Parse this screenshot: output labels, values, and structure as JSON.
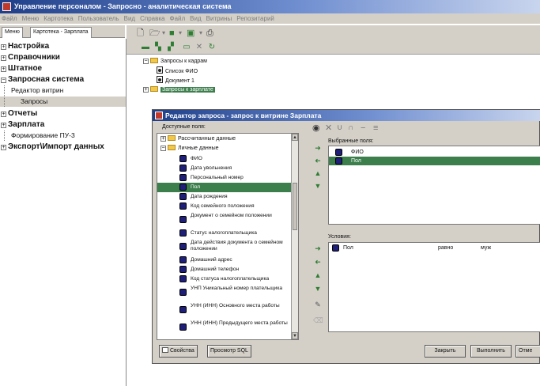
{
  "window": {
    "title": "Управление персоналом - Запросно - аналитическая система"
  },
  "menubar": [
    "Файл",
    "Меню",
    "Картотека",
    "Пользователь",
    "Вид",
    "Справка",
    "Файл",
    "Вид",
    "Витрины",
    "Репозитарий"
  ],
  "tabs": [
    "Меню",
    "Картотека - Зарплата"
  ],
  "tree": [
    {
      "label": "Настройка",
      "expander": "+",
      "bold": true
    },
    {
      "label": "Справочники",
      "expander": "+",
      "bold": true
    },
    {
      "label": "Штатное",
      "expander": "+",
      "bold": true
    },
    {
      "label": "Запросная система",
      "expander": "−",
      "bold": true
    },
    {
      "label": "Редактор витрин",
      "expander": "",
      "bold": false
    },
    {
      "label": "Запросы",
      "expander": "",
      "bold": false,
      "selected": true
    },
    {
      "label": "Отчеты",
      "expander": "+",
      "bold": true
    },
    {
      "label": "Зарплата",
      "expander": "+",
      "bold": true
    },
    {
      "label": "Формирование ПУ-3",
      "expander": "",
      "bold": false
    },
    {
      "label": "Экспорт\\Импорт данных",
      "expander": "+",
      "bold": true
    }
  ],
  "query_tree": [
    {
      "label": "Запросы к кадрам",
      "type": "folder",
      "expander": "−"
    },
    {
      "label": "Список ФИО",
      "type": "doc"
    },
    {
      "label": "Документ 1",
      "type": "doc"
    },
    {
      "label": "Запросы к зарплате",
      "type": "folder",
      "expander": "+",
      "selected": true
    }
  ],
  "dialog": {
    "title": "Редактор запроса - запрос к витрине Зарплата",
    "available_label": "Доступные поля:",
    "selected_label": "Выбранные поля:",
    "conditions_label": "Условия:",
    "groups": [
      "Рассчитанные данные",
      "Личные данные"
    ],
    "available_fields": [
      "ФИО",
      "Дата увольнения",
      "Персональный номер",
      "Пол",
      "Дата рождения",
      "Код семейного положения",
      "Документ о семейном положении",
      "Статус налогоплательщика",
      "Дата действия документа о семейном положении",
      "Домашний адрес",
      "Домашний телефон",
      "Код статуса налогоплательщика",
      "УНП Уникальный номер плательщика",
      "УНН (ИНН) Основного места работы",
      "УНН (ИНН) Предыдущего места работы"
    ],
    "selected_field_index": 3,
    "selected_fields": [
      {
        "label": "ФИО",
        "selected": false
      },
      {
        "label": "Пол",
        "selected": true
      }
    ],
    "condition": {
      "field": "Пол",
      "op": "равно",
      "value": "муж"
    },
    "buttons": {
      "properties": "Свойства",
      "sql": "Просмотр SQL",
      "close": "Закрыть",
      "run": "Выполнить",
      "cancel": "Отме"
    }
  }
}
